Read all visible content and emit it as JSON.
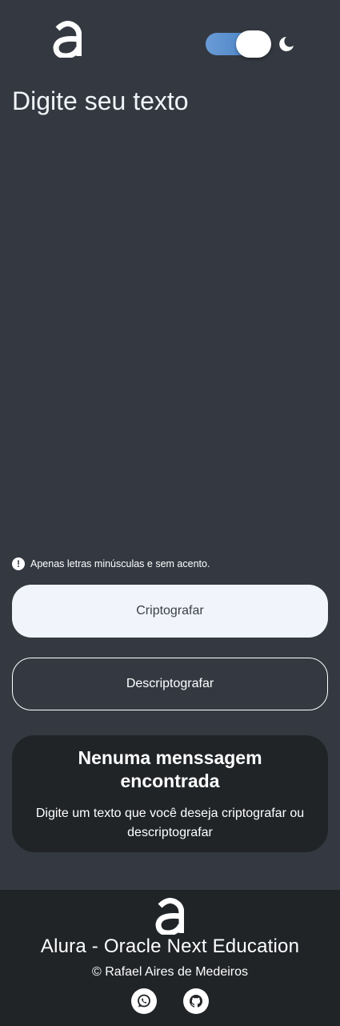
{
  "header": {
    "logo_icon": "alura-logo",
    "theme_toggle": {
      "state": "on",
      "track_color": "#4f89c8",
      "knob_color": "#ffffff"
    },
    "theme_icon": "moon-icon"
  },
  "input": {
    "placeholder": "Digite seu texto",
    "value": ""
  },
  "hint": {
    "icon": "exclamation-icon",
    "text": "Apenas letras minúsculas e sem acento."
  },
  "buttons": {
    "encrypt_label": "Criptografar",
    "decrypt_label": "Descriptografar"
  },
  "output": {
    "title": "Nenuma menssagem encontrada",
    "message": "Digite um texto que você deseja criptografar ou descriptografar"
  },
  "footer": {
    "logo_icon": "alura-logo",
    "title": "Alura - Oracle Next Education",
    "credit": "© Rafael Aires de Medeiros",
    "social": [
      {
        "name": "whatsapp",
        "icon": "whatsapp-icon"
      },
      {
        "name": "github",
        "icon": "github-icon"
      }
    ]
  },
  "colors": {
    "background": "#343941",
    "card": "#212427",
    "footer": "#212427",
    "primary_button": "#f1f4fb",
    "text": "#ffffff"
  }
}
